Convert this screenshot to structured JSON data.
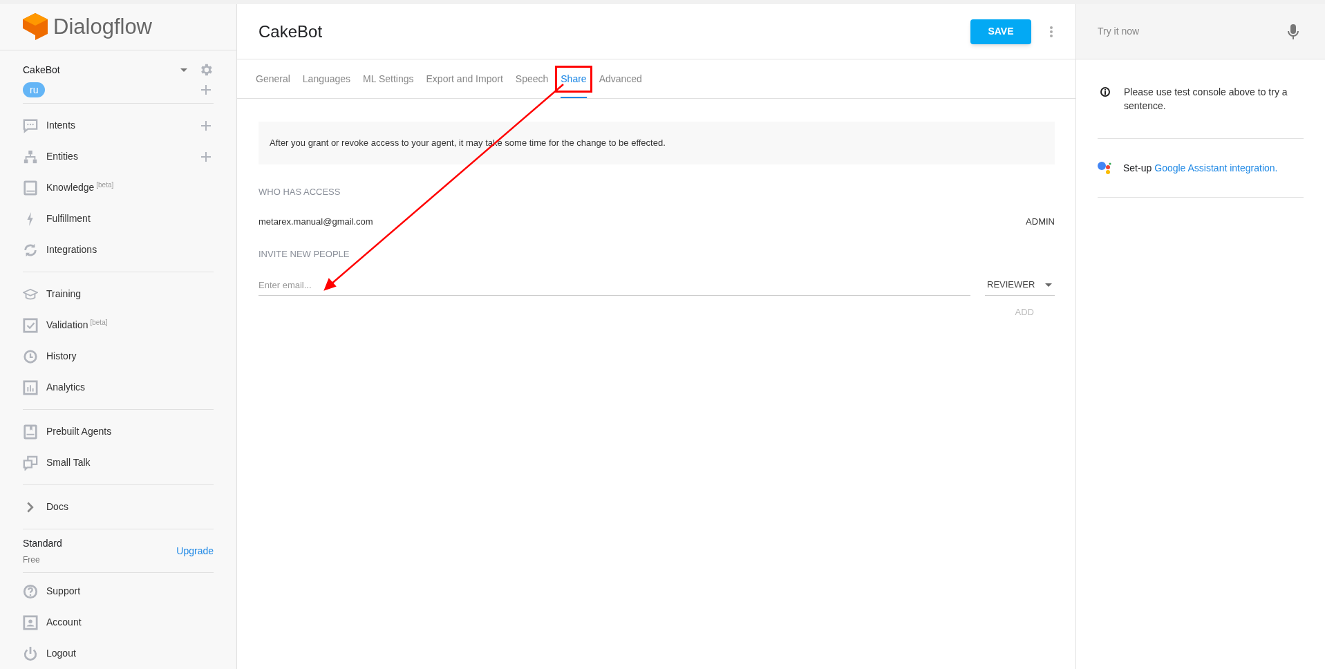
{
  "logo": {
    "text": "Dialogflow"
  },
  "agent": {
    "name": "CakeBot",
    "language": "ru"
  },
  "sidebar": {
    "sections": [
      [
        {
          "label": "Intents",
          "add": true
        },
        {
          "label": "Entities",
          "add": true
        },
        {
          "label": "Knowledge",
          "beta": "[beta]",
          "add": false
        },
        {
          "label": "Fulfillment",
          "add": false
        },
        {
          "label": "Integrations",
          "add": false
        }
      ],
      [
        {
          "label": "Training",
          "add": false
        },
        {
          "label": "Validation",
          "beta": "[beta]",
          "add": false
        },
        {
          "label": "History",
          "add": false
        },
        {
          "label": "Analytics",
          "add": false
        }
      ],
      [
        {
          "label": "Prebuilt Agents",
          "add": false
        },
        {
          "label": "Small Talk",
          "add": false
        }
      ],
      [
        {
          "label": "Docs",
          "add": false
        }
      ]
    ],
    "plan": {
      "name": "Standard",
      "tier": "Free",
      "upgrade": "Upgrade"
    },
    "footer": [
      {
        "label": "Support"
      },
      {
        "label": "Account"
      },
      {
        "label": "Logout"
      }
    ]
  },
  "header": {
    "title": "CakeBot",
    "save": "SAVE"
  },
  "tabs": [
    {
      "label": "General",
      "selected": false,
      "highlighted": false
    },
    {
      "label": "Languages",
      "selected": false,
      "highlighted": false
    },
    {
      "label": "ML Settings",
      "selected": false,
      "highlighted": false
    },
    {
      "label": "Export and Import",
      "selected": false,
      "highlighted": false
    },
    {
      "label": "Speech",
      "selected": false,
      "highlighted": false
    },
    {
      "label": "Share",
      "selected": true,
      "highlighted": true
    },
    {
      "label": "Advanced",
      "selected": false,
      "highlighted": false
    }
  ],
  "share": {
    "notice": "After you grant or revoke access to your agent, it may take some time for the change to be effected.",
    "access_heading": "WHO HAS ACCESS",
    "members": [
      {
        "email": "metarex.manual@gmail.com",
        "role": "ADMIN"
      }
    ],
    "invite_heading": "INVITE NEW PEOPLE",
    "email_field": {
      "placeholder": "Enter email..."
    },
    "role": "REVIEWER",
    "add": "ADD"
  },
  "console": {
    "placeholder": "Try it now",
    "info": "Please use test console above to try a sentence.",
    "setup": "Set-up",
    "setup_link": "Google Assistant integration."
  }
}
